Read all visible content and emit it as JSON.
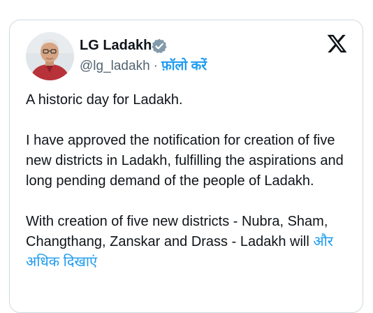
{
  "tweet": {
    "display_name": "LG Ladakh",
    "handle": "@lg_ladakh",
    "separator": "·",
    "follow_label": "फ़ॉलो करें",
    "paragraph1": "A historic day for Ladakh.",
    "paragraph2": "I have approved the notification for creation of five new districts in Ladakh, fulfilling the aspirations and long pending demand of the people of Ladakh.",
    "paragraph3": "With creation of five new districts - Nubra, Sham, Changthang, Zanskar and Drass - Ladakh will",
    "show_more_label": "और अधिक दिखाएं"
  },
  "icons": {
    "verified": "verified-badge-icon",
    "platform": "x-logo-icon"
  },
  "colors": {
    "accent": "#1d9bf0",
    "text_primary": "#0f1419",
    "text_secondary": "#536471",
    "border": "#cfd9de",
    "verified_badge": "#829aab"
  }
}
